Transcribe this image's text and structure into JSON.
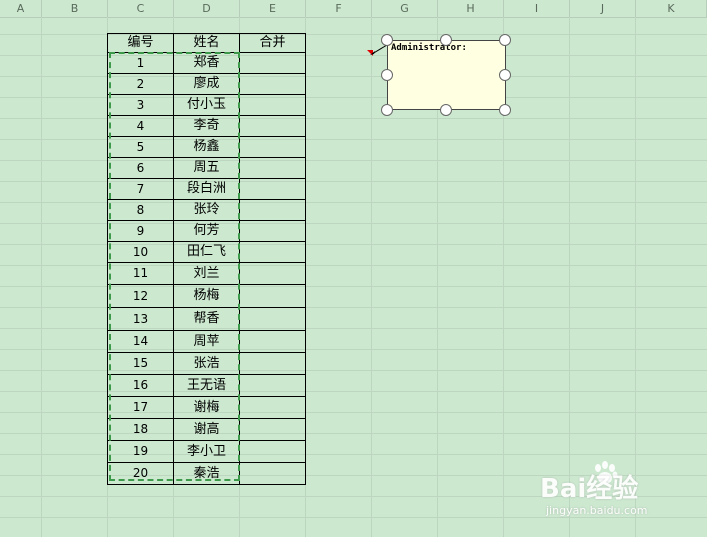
{
  "columns": [
    "A",
    "B",
    "C",
    "D",
    "E",
    "F",
    "G",
    "H",
    "I",
    "J",
    "K"
  ],
  "table": {
    "headers": [
      "编号",
      "姓名",
      "合并"
    ],
    "rows": [
      {
        "id": "1",
        "name": "郑香"
      },
      {
        "id": "2",
        "name": "廖成"
      },
      {
        "id": "3",
        "name": "付小玉"
      },
      {
        "id": "4",
        "name": "李奇"
      },
      {
        "id": "5",
        "name": "杨鑫"
      },
      {
        "id": "6",
        "name": "周五"
      },
      {
        "id": "7",
        "name": "段白洲"
      },
      {
        "id": "8",
        "name": "张玲"
      },
      {
        "id": "9",
        "name": "何芳"
      },
      {
        "id": "10",
        "name": "田仁飞"
      },
      {
        "id": "11",
        "name": "刘兰"
      },
      {
        "id": "12",
        "name": "杨梅"
      },
      {
        "id": "13",
        "name": "帮香"
      },
      {
        "id": "14",
        "name": "周苹"
      },
      {
        "id": "15",
        "name": "张浩"
      },
      {
        "id": "16",
        "name": "王无语"
      },
      {
        "id": "17",
        "name": "谢梅"
      },
      {
        "id": "18",
        "name": "谢高"
      },
      {
        "id": "19",
        "name": "李小卫"
      },
      {
        "id": "20",
        "name": "秦浩"
      }
    ]
  },
  "comment": {
    "author": "Administrator:"
  },
  "watermark": {
    "brand": "Bai经验",
    "url": "jingyan.baidu.com"
  },
  "colors": {
    "sheet_bg": "#cce8cf",
    "selection_dash": "#3d9a4a",
    "comment_bg": "#ffffe1"
  }
}
